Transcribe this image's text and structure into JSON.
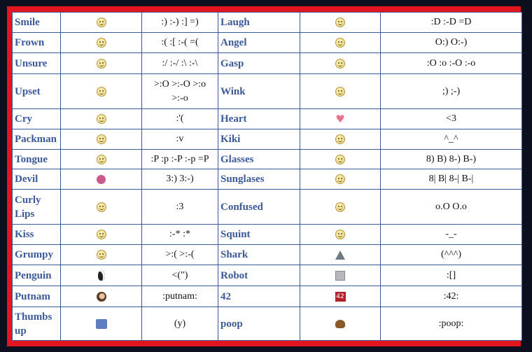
{
  "rows": [
    [
      {
        "name": "Smile",
        "icon": "smile-icon",
        "code": ":) :-) :] =)"
      },
      {
        "name": "Laugh",
        "icon": "laugh-icon",
        "code": ":D :-D =D"
      }
    ],
    [
      {
        "name": "Frown",
        "icon": "frown-icon",
        "code": ":( :[ :-( =("
      },
      {
        "name": "Angel",
        "icon": "angel-icon",
        "code": "O:) O:-)"
      }
    ],
    [
      {
        "name": "Unsure",
        "icon": "unsure-icon",
        "code": ":/ :-/ :\\ :-\\"
      },
      {
        "name": "Gasp",
        "icon": "gasp-icon",
        "code": ":O :o :-O :-o"
      }
    ],
    [
      {
        "name": "Upset",
        "icon": "upset-icon",
        "code": ">:O >:-O >:o >:-o"
      },
      {
        "name": "Wink",
        "icon": "wink-icon",
        "code": ";) ;-)"
      }
    ],
    [
      {
        "name": "Cry",
        "icon": "cry-icon",
        "code": ":'("
      },
      {
        "name": "Heart",
        "icon": "heart-icon",
        "code": "<3"
      }
    ],
    [
      {
        "name": "Packman",
        "icon": "packman-icon",
        "code": ":v"
      },
      {
        "name": "Kiki",
        "icon": "kiki-icon",
        "code": "^_^"
      }
    ],
    [
      {
        "name": "Tongue",
        "icon": "tongue-icon",
        "code": ":P :p :-P :-p =P"
      },
      {
        "name": "Glasses",
        "icon": "glasses-icon",
        "code": "8) B) 8-) B-)"
      }
    ],
    [
      {
        "name": "Devil",
        "icon": "devil-icon",
        "code": "3:) 3:-)"
      },
      {
        "name": "Sunglases",
        "icon": "sunglasses-icon",
        "code": "8| B| 8-| B-|"
      }
    ],
    [
      {
        "name": "Curly Lips",
        "icon": "curly-lips-icon",
        "code": ":3"
      },
      {
        "name": "Confused",
        "icon": "confused-icon",
        "code": "o.O O.o"
      }
    ],
    [
      {
        "name": "Kiss",
        "icon": "kiss-icon",
        "code": ":-* :*"
      },
      {
        "name": "Squint",
        "icon": "squint-icon",
        "code": "-_-"
      }
    ],
    [
      {
        "name": "Grumpy",
        "icon": "grumpy-icon",
        "code": ">:( >:-("
      },
      {
        "name": "Shark",
        "icon": "shark-icon",
        "code": "(^^^)"
      }
    ],
    [
      {
        "name": "Penguin",
        "icon": "penguin-icon",
        "code": "<(\")"
      },
      {
        "name": "Robot",
        "icon": "robot-icon",
        "code": ":[]"
      }
    ],
    [
      {
        "name": "Putnam",
        "icon": "putnam-icon",
        "code": ":putnam:"
      },
      {
        "name": "42",
        "icon": "42-icon",
        "code": ":42:",
        "icon_text": "42"
      }
    ],
    [
      {
        "name": "Thumbs up",
        "icon": "thumbs-up-icon",
        "code": "(y)"
      },
      {
        "name": "poop",
        "icon": "poop-icon",
        "code": ":poop:"
      }
    ]
  ],
  "colors": {
    "name_text": "#3b5998",
    "frame_red": "#e3151f",
    "outer": "#0b0f1e"
  }
}
